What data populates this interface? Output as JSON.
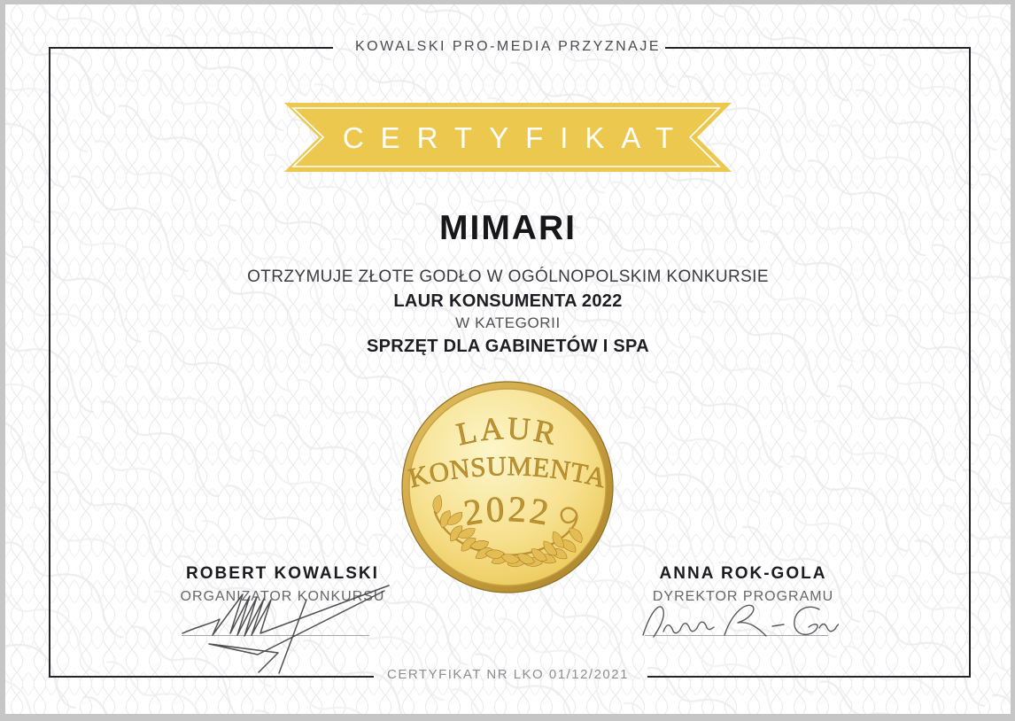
{
  "header": {
    "text": "KOWALSKI PRO-MEDIA PRZYZNAJE"
  },
  "ribbon": {
    "text": "CERTYFIKAT",
    "color": "#ecc84e"
  },
  "recipient": {
    "name": "MIMARI"
  },
  "statement": {
    "line1": "OTRZYMUJE ZŁOTE GODŁO W OGÓLNOPOLSKIM KONKURSIE",
    "award": "LAUR KONSUMENTA 2022",
    "line2": "W KATEGORII",
    "category": "SPRZĘT DLA GABINETÓW I SPA"
  },
  "medal": {
    "word1": "LAUR",
    "word2": "KONSUMENTA",
    "year": "2022",
    "gold_light": "#fdf4c4",
    "gold_dark": "#e7c24a"
  },
  "signatures": {
    "left": {
      "name": "ROBERT KOWALSKI",
      "role": "ORGANIZATOR KONKURSU"
    },
    "right": {
      "name": "ANNA ROK-GOLA",
      "role": "DYREKTOR PROGRAMU"
    }
  },
  "footer": {
    "text": "CERTYFIKAT NR LKO 01/12/2021"
  }
}
